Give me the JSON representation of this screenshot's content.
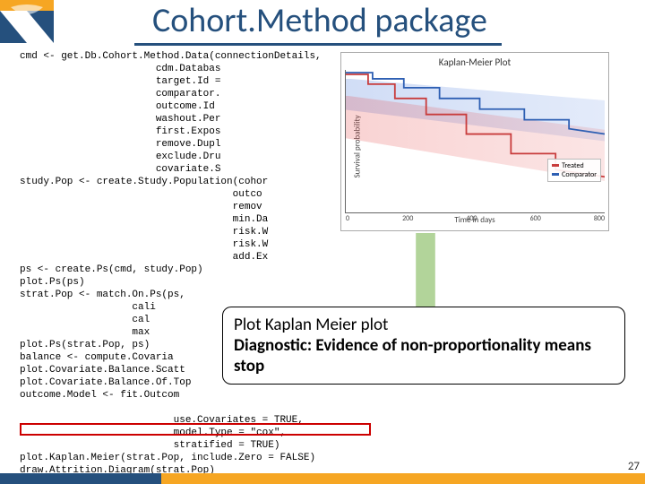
{
  "title": "Cohort.Method package",
  "page_number": "27",
  "code_text": "cmd <- get.Db.Cohort.Method.Data(connectionDetails,\n                       cdm.Databas\n                       target.Id =\n                       comparator.\n                       outcome.Id\n                       washout.Per\n                       first.Expos\n                       remove.Dupl\n                       exclude.Dru\n                       covariate.S\nstudy.Pop <- create.Study.Population(cohor\n                                    outco\n                                    remov\n                                    min.Da\n                                    risk.W\n                                    risk.W\n                                    add.Ex\nps <- create.Ps(cmd, study.Pop)\nplot.Ps(ps)\nstrat.Pop <- match.On.Ps(ps,\n                   cali\n                   cal\n                   max\nplot.Ps(strat.Pop, ps)\nbalance <- compute.Covaria\nplot.Covariate.Balance.Scatt\nplot.Covariate.Balance.Of.Top\noutcome.Model <- fit.Outcom\n\n                          use.Covariates = TRUE,\n                          model.Type = \"cox\",\n                          stratified = TRUE)\nplot.Kaplan.Meier(strat.Pop, include.Zero = FALSE)\ndraw.Attrition.Diagram(strat.Pop)\noutcome.Model",
  "callout": {
    "line1": "Plot Kaplan Meier plot",
    "line2": "Diagnostic: Evidence of non-proportionality means stop"
  },
  "chart_data": {
    "type": "line",
    "title": "Kaplan-Meier Plot",
    "xlabel": "Time in days",
    "ylabel": "Survival probability",
    "xlim": [
      0,
      800
    ],
    "ylim": [
      0.4,
      1.0
    ],
    "x_ticks": [
      0,
      200,
      400,
      600,
      800
    ],
    "series": [
      {
        "name": "Treated",
        "color": "#c83c3c",
        "x": [
          0,
          80,
          160,
          260,
          380,
          520,
          680,
          800
        ],
        "y": [
          1.0,
          0.95,
          0.88,
          0.8,
          0.72,
          0.64,
          0.57,
          0.52
        ]
      },
      {
        "name": "Comparator",
        "color": "#2e5fb3",
        "x": [
          0,
          80,
          160,
          260,
          380,
          520,
          680,
          800
        ],
        "y": [
          1.0,
          0.97,
          0.93,
          0.88,
          0.84,
          0.8,
          0.76,
          0.73
        ]
      }
    ],
    "legend_position": "right-middle"
  },
  "colors": {
    "brand_blue": "#25507d",
    "brand_orange": "#f6a623",
    "treated": "#c83c3c",
    "comparator": "#2e5fb3",
    "arrow_green": "#aacf8f",
    "highlight_red": "#c00"
  }
}
